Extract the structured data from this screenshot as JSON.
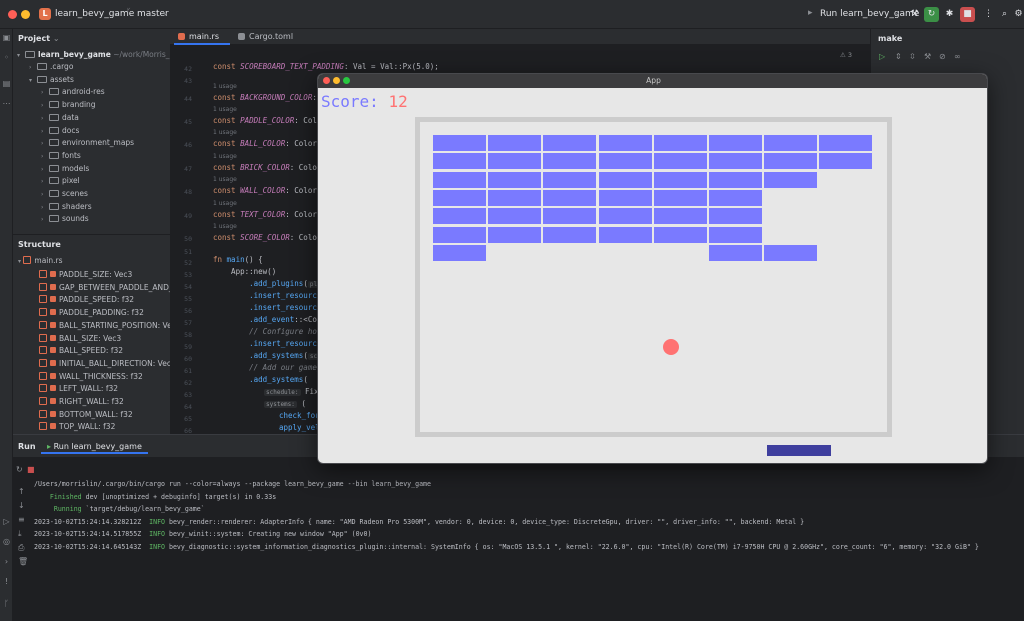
{
  "titlebar": {
    "project_badge": "L",
    "project_name": "learn_bevy_game",
    "branch": "master",
    "run_config": "Run learn_bevy_game"
  },
  "project_panel": {
    "title": "Project",
    "root": {
      "name": "learn_bevy_game",
      "path": "~/work/Morris_Proj"
    },
    "items": [
      {
        "name": ".cargo",
        "depth": 1
      },
      {
        "name": "assets",
        "depth": 1,
        "expanded": true
      },
      {
        "name": "android-res",
        "depth": 2
      },
      {
        "name": "branding",
        "depth": 2
      },
      {
        "name": "data",
        "depth": 2
      },
      {
        "name": "docs",
        "depth": 2
      },
      {
        "name": "environment_maps",
        "depth": 2
      },
      {
        "name": "fonts",
        "depth": 2
      },
      {
        "name": "models",
        "depth": 2
      },
      {
        "name": "pixel",
        "depth": 2
      },
      {
        "name": "scenes",
        "depth": 2
      },
      {
        "name": "shaders",
        "depth": 2
      },
      {
        "name": "sounds",
        "depth": 2
      }
    ]
  },
  "structure_panel": {
    "title": "Structure",
    "file": "main.rs",
    "items": [
      "PADDLE_SIZE: Vec3",
      "GAP_BETWEEN_PADDLE_AND_F",
      "PADDLE_SPEED: f32",
      "PADDLE_PADDING: f32",
      "BALL_STARTING_POSITION: Vec",
      "BALL_SIZE: Vec3",
      "BALL_SPEED: f32",
      "INITIAL_BALL_DIRECTION: Vec2",
      "WALL_THICKNESS: f32",
      "LEFT_WALL: f32",
      "RIGHT_WALL: f32",
      "BOTTOM_WALL: f32",
      "TOP_WALL: f32"
    ]
  },
  "editor": {
    "tabs": [
      "main.rs",
      "Cargo.toml"
    ],
    "usage_hint": "1 usage",
    "inspection_count": "3",
    "line_numbers": [
      "42",
      "43",
      "44",
      "45",
      "46",
      "47",
      "48",
      "49",
      "50",
      "51",
      "52",
      "53",
      "54",
      "55",
      "56",
      "57",
      "58",
      "59",
      "60",
      "61",
      "62",
      "63",
      "64",
      "65",
      "66",
      "67"
    ],
    "lines": {
      "l42": "const SCOREBOARD_TEXT_PADDING: Val = Val::Px(5.0);",
      "l44": "const BACKGROUND_COLOR: C",
      "l45": "const PADDLE_COLOR: Color",
      "l46": "const BALL_COLOR: Color =",
      "l47": "const BRICK_COLOR: Color",
      "l48": "const WALL_COLOR: Color =",
      "l49": "const TEXT_COLOR: Color =",
      "l50": "const SCORE_COLOR: Color",
      "l52": "fn main() {",
      "l53": "    App::new()",
      "l54": "        .add_plugins(",
      "l54_hint": "plugi",
      "l55": "        .insert_resource(",
      "l56": "        .insert_resource(",
      "l57": "        .add_event::<Coll",
      "l58": "        // Configure how",
      "l59": "        .insert_resource(",
      "l60": "        .add_systems(",
      "l60_hint": "sche",
      "l61": "        // Add our gamepl",
      "l62": "        .add_systems(",
      "l63_hint": "schedule:",
      "l63": "Fixe",
      "l64_hint": "systems:",
      "l64": "(",
      "l65": "check_for",
      "l66": "apply_vel",
      "l67": "move_padd"
    }
  },
  "make_panel": {
    "title": "make"
  },
  "run_panel": {
    "label": "Run",
    "tab": "Run learn_bevy_game",
    "console": [
      {
        "text": "/Users/morrislin/.cargo/bin/cargo run --color=always --package learn_bevy_game --bin learn_bevy_game",
        "style": "normal"
      },
      {
        "text": "    Finished dev [unoptimized + debuginfo] target(s) in 0.33s",
        "style": "green-lead",
        "lead": "    Finished",
        "rest": " dev [unoptimized + debuginfo] target(s) in 0.33s"
      },
      {
        "text": "     Running `target/debug/learn_bevy_game`",
        "style": "green-lead",
        "lead": "     Running",
        "rest": " `target/debug/learn_bevy_game`"
      },
      {
        "text": "2023-10-02T15:24:14.328212Z  INFO bevy_render::renderer: AdapterInfo { name: \"AMD Radeon Pro 5300M\", vendor: 0, device: 0, device_type: DiscreteGpu, driver: \"\", driver_info: \"\", backend: Metal }",
        "style": "log",
        "ts": "2023-10-02T15:24:14.328212Z",
        "level": "INFO",
        "msg": " bevy_render::renderer: AdapterInfo { name: \"AMD Radeon Pro 5300M\", vendor: 0, device: 0, device_type: DiscreteGpu, driver: \"\", driver_info: \"\", backend: Metal }"
      },
      {
        "text": "2023-10-02T15:24:14.517855Z  INFO bevy_winit::system: Creating new window \"App\" (0v0)",
        "style": "log",
        "ts": "2023-10-02T15:24:14.517855Z",
        "level": "INFO",
        "msg": " bevy_winit::system: Creating new window \"App\" (0v0)"
      },
      {
        "text": "2023-10-02T15:24:14.645143Z  INFO bevy_diagnostic::system_information_diagnostics_plugin::internal: SystemInfo { os: \"MacOS 13.5.1 \", kernel: \"22.6.0\", cpu: \"Intel(R) Core(TM) i7-9750H CPU @ 2.60GHz\", core_count: \"6\", memory: \"32.0 GiB\" }",
        "style": "log",
        "ts": "2023-10-02T15:24:14.645143Z",
        "level": "INFO",
        "msg": " bevy_diagnostic::system_information_diagnostics_plugin::internal: SystemInfo { os: \"MacOS 13.5.1 \", kernel: \"22.6.0\", cpu: \"Intel(R) Core(TM) i7-9750H CPU @ 2.60GHz\", core_count: \"6\", memory: \"32.0 GiB\" }"
      }
    ]
  },
  "app_window": {
    "title": "App",
    "score_label": "Score: ",
    "score_value": "12",
    "colors": {
      "brick": "#7a7aff",
      "ball": "#ff7272",
      "paddle": "#3f3f9e",
      "wall": "#cccccc",
      "background": "#e7e7e7",
      "score_label": "#7a7aff",
      "score_value": "#ff7272"
    },
    "brick_rows": [
      [
        1,
        1,
        1,
        1,
        1,
        1,
        1,
        1
      ],
      [
        1,
        1,
        1,
        1,
        1,
        1,
        1,
        1
      ],
      [
        1,
        1,
        1,
        1,
        1,
        1,
        1,
        0
      ],
      [
        1,
        1,
        1,
        1,
        1,
        1,
        0,
        0
      ],
      [
        1,
        1,
        1,
        1,
        1,
        1,
        0,
        0
      ],
      [
        1,
        1,
        1,
        1,
        1,
        1,
        0,
        0
      ],
      [
        1,
        0,
        0,
        0,
        0,
        1,
        1,
        0
      ]
    ]
  }
}
